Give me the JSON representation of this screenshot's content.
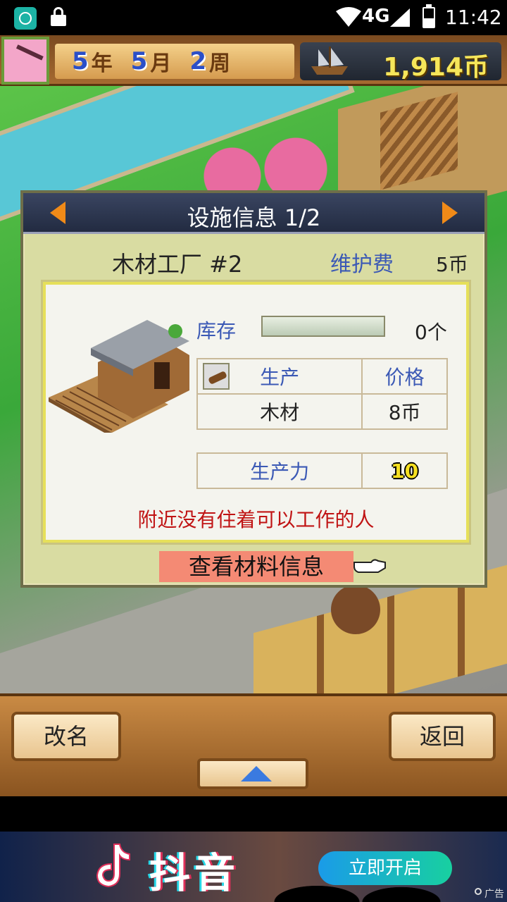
{
  "status_bar": {
    "network": "4G",
    "time": "11:42"
  },
  "hud": {
    "year_num": "5",
    "year_unit": "年",
    "month_num": "5",
    "month_unit": "月",
    "week_num": "2",
    "week_unit": "周",
    "money": "1,914币"
  },
  "dialog": {
    "title": "设施信息 1/2",
    "facility_name": "木材工厂 #2",
    "maintenance_label": "维护费",
    "maintenance_value": "5币",
    "stock_label": "库存",
    "stock_value": "0个",
    "stock_fill": 0,
    "production_header": "生产",
    "price_header": "价格",
    "product": "木材",
    "price": "8币",
    "productivity_label": "生产力",
    "productivity_value": "10",
    "warning": "附近没有住着可以工作的人",
    "material_button": "查看材料信息"
  },
  "bottom_bar": {
    "rename": "改名",
    "back": "返回"
  },
  "ad": {
    "brand": "抖音",
    "cta": "立即开启",
    "tag": "广告"
  },
  "colors": {
    "accent_blue": "#3b59b5",
    "warning_red": "#c01414",
    "money_yellow": "#f6e65a",
    "arrow_orange": "#f08a18"
  }
}
